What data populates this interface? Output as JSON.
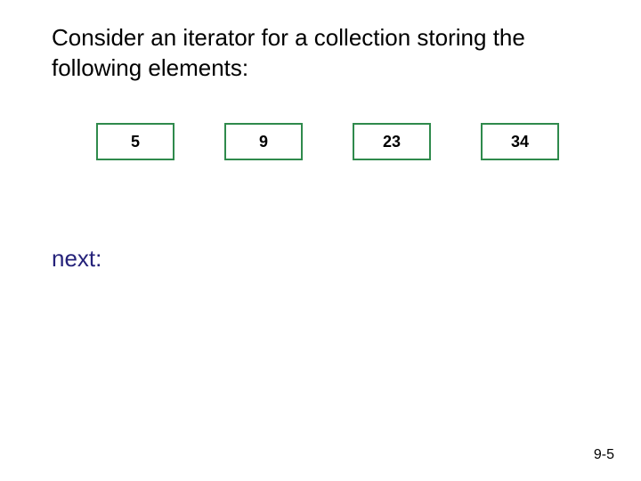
{
  "description": "Consider an iterator for a collection storing the following elements:",
  "elements": {
    "0": "5",
    "1": "9",
    "2": "23",
    "3": "34"
  },
  "next_label": "next:",
  "footer": "9-5"
}
